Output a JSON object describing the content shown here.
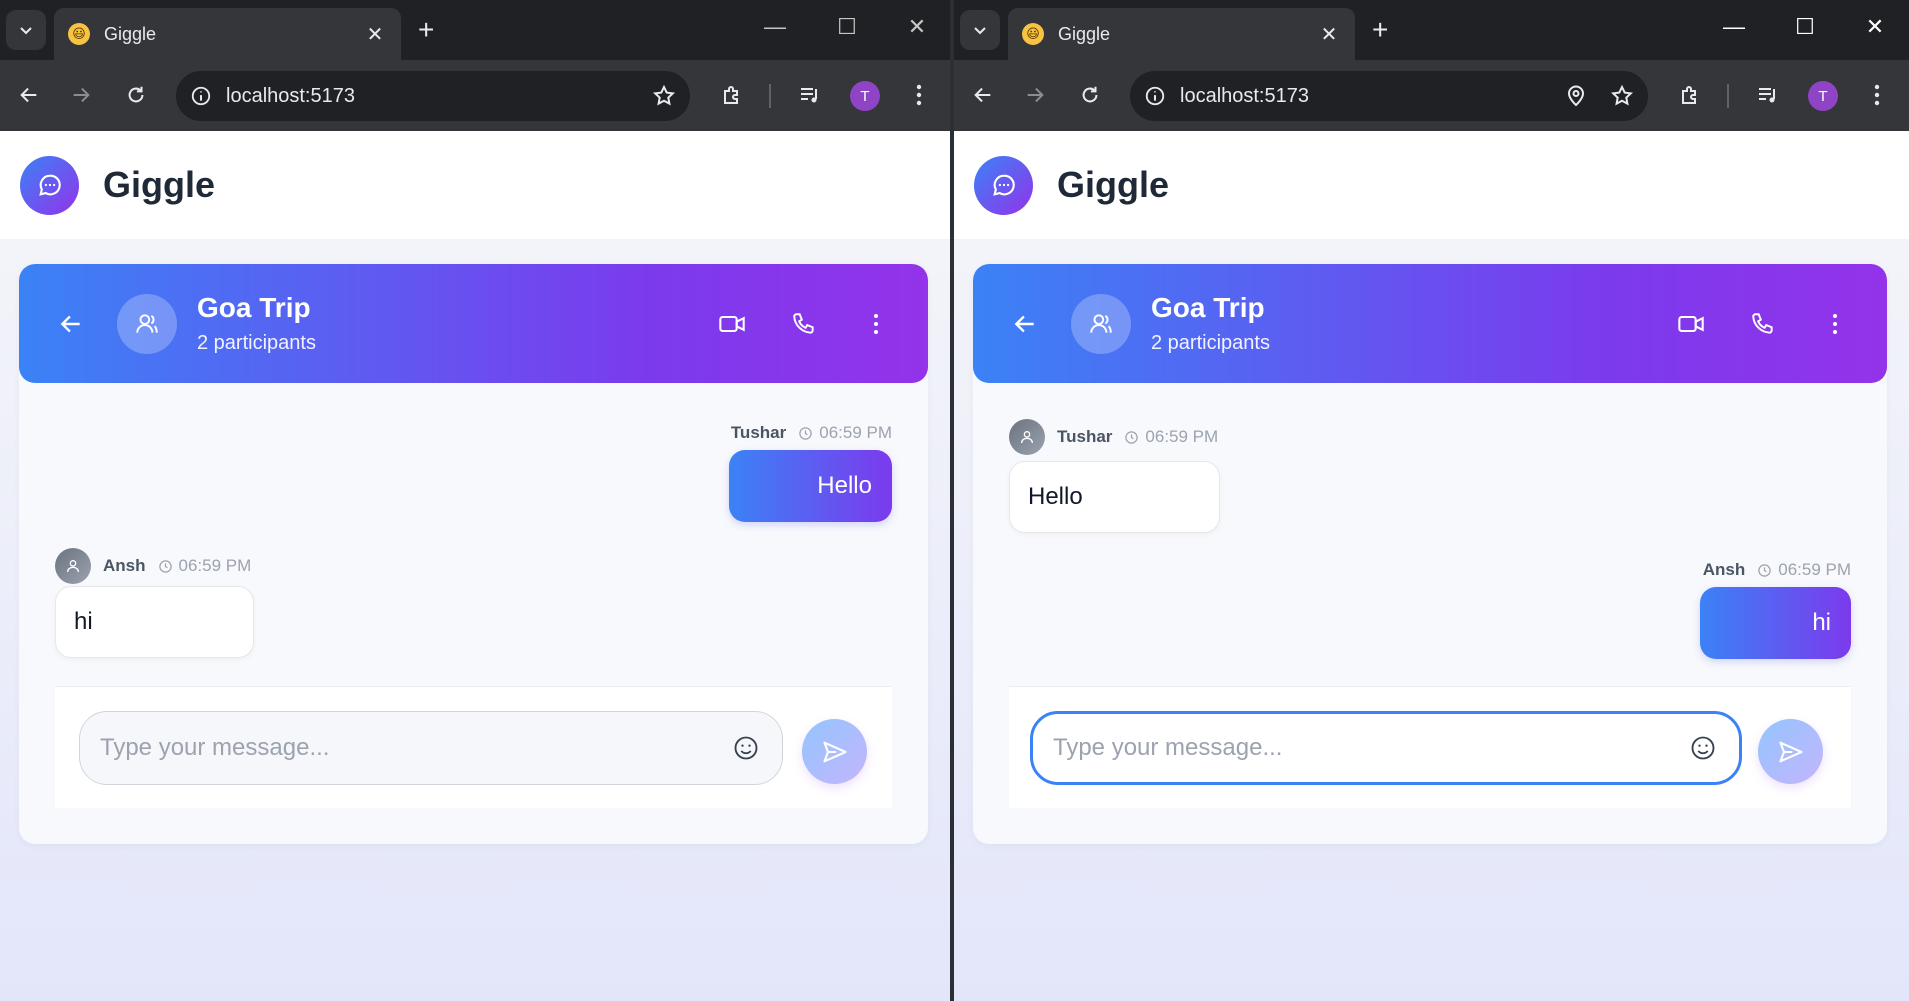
{
  "browser": {
    "tab_title": "Giggle",
    "favicon_glyph": "😃",
    "close_glyph": "✕",
    "newtab_glyph": "+",
    "minimize_glyph": "—",
    "maximize_glyph": "☐",
    "window_close_glyph": "✕",
    "url": "localhost:5173",
    "profile_initial": "T"
  },
  "app": {
    "name": "Giggle"
  },
  "chat": {
    "group_name": "Goa Trip",
    "participants": "2 participants"
  },
  "input": {
    "placeholder": "Type your message..."
  },
  "left": {
    "messages": [
      {
        "sender": "Tushar",
        "time": "06:59 PM",
        "text": "Hello",
        "direction": "outgoing"
      },
      {
        "sender": "Ansh",
        "time": "06:59 PM",
        "text": "hi",
        "direction": "incoming"
      }
    ]
  },
  "right": {
    "messages": [
      {
        "sender": "Tushar",
        "time": "06:59 PM",
        "text": "Hello",
        "direction": "incoming"
      },
      {
        "sender": "Ansh",
        "time": "06:59 PM",
        "text": "hi",
        "direction": "outgoing"
      }
    ],
    "input_focused": true
  },
  "colors": {
    "accent_start": "#3b82f6",
    "accent_end": "#9333ea",
    "focus_ring": "#3b82f6",
    "browser_dark": "#202124",
    "browser_mid": "#35363a",
    "profile": "#8e44c4"
  },
  "icons": {
    "header_logo": "chat-bubble-icon",
    "back": "arrow-left-icon",
    "group_avatar": "users-icon",
    "video": "video-icon",
    "phone": "phone-icon",
    "menu": "more-vertical-icon",
    "clock": "clock-icon",
    "user": "user-icon",
    "emoji": "smile-icon",
    "send": "send-icon",
    "location": "location-pin-icon",
    "star": "star-icon",
    "extension": "puzzle-icon",
    "media": "media-control-icon",
    "kebab": "browser-menu-icon"
  }
}
